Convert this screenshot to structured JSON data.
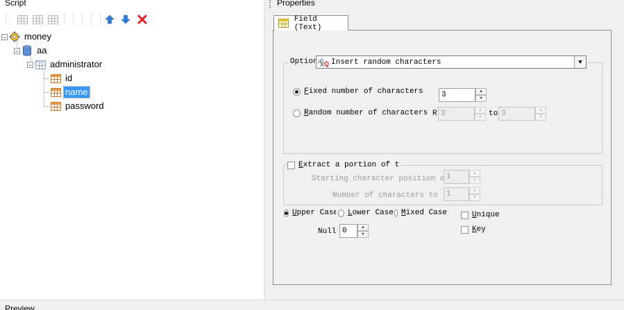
{
  "script_pane": {
    "title": "Script",
    "toolbar": {
      "icons": [
        "grid-icon",
        "grid-icon",
        "grid-icon",
        "arrow-up-icon",
        "arrow-down-icon",
        "delete-icon"
      ]
    },
    "tree": {
      "root": "money",
      "database": "aa",
      "table": "administrator",
      "fields": [
        "id",
        "name",
        "password"
      ],
      "selected": "name"
    }
  },
  "properties_pane": {
    "title": "Properties",
    "tab_label": "Field (Text)",
    "option_label": "Option",
    "option_value": "Insert random characters",
    "fixed_label": "ixed number of characters",
    "fixed_mnemonic": "F",
    "fixed_value": "3",
    "random_label": "andom number of characters",
    "random_mnemonic": "R",
    "random_from_prefix": "R",
    "random_from_value": "3",
    "random_to_label": "to",
    "random_to_value": "3",
    "extract_label": "xtract a portion of t",
    "extract_mnemonic": "E",
    "start_label": "Starting character position of",
    "start_value": "1",
    "count_label": "Number of characters to",
    "count_value": "1",
    "upper_label": "pper Case",
    "upper_mnemonic": "U",
    "lower_label": "ower Case",
    "lower_mnemonic": "L",
    "mixed_label": "ixed Case",
    "mixed_mnemonic": "M",
    "unique_label": "nique",
    "unique_mnemonic": "U",
    "key_label": "ey",
    "key_mnemonic": "K",
    "null_label": "Null",
    "null_value": "0"
  },
  "bottom_title": "Preview"
}
